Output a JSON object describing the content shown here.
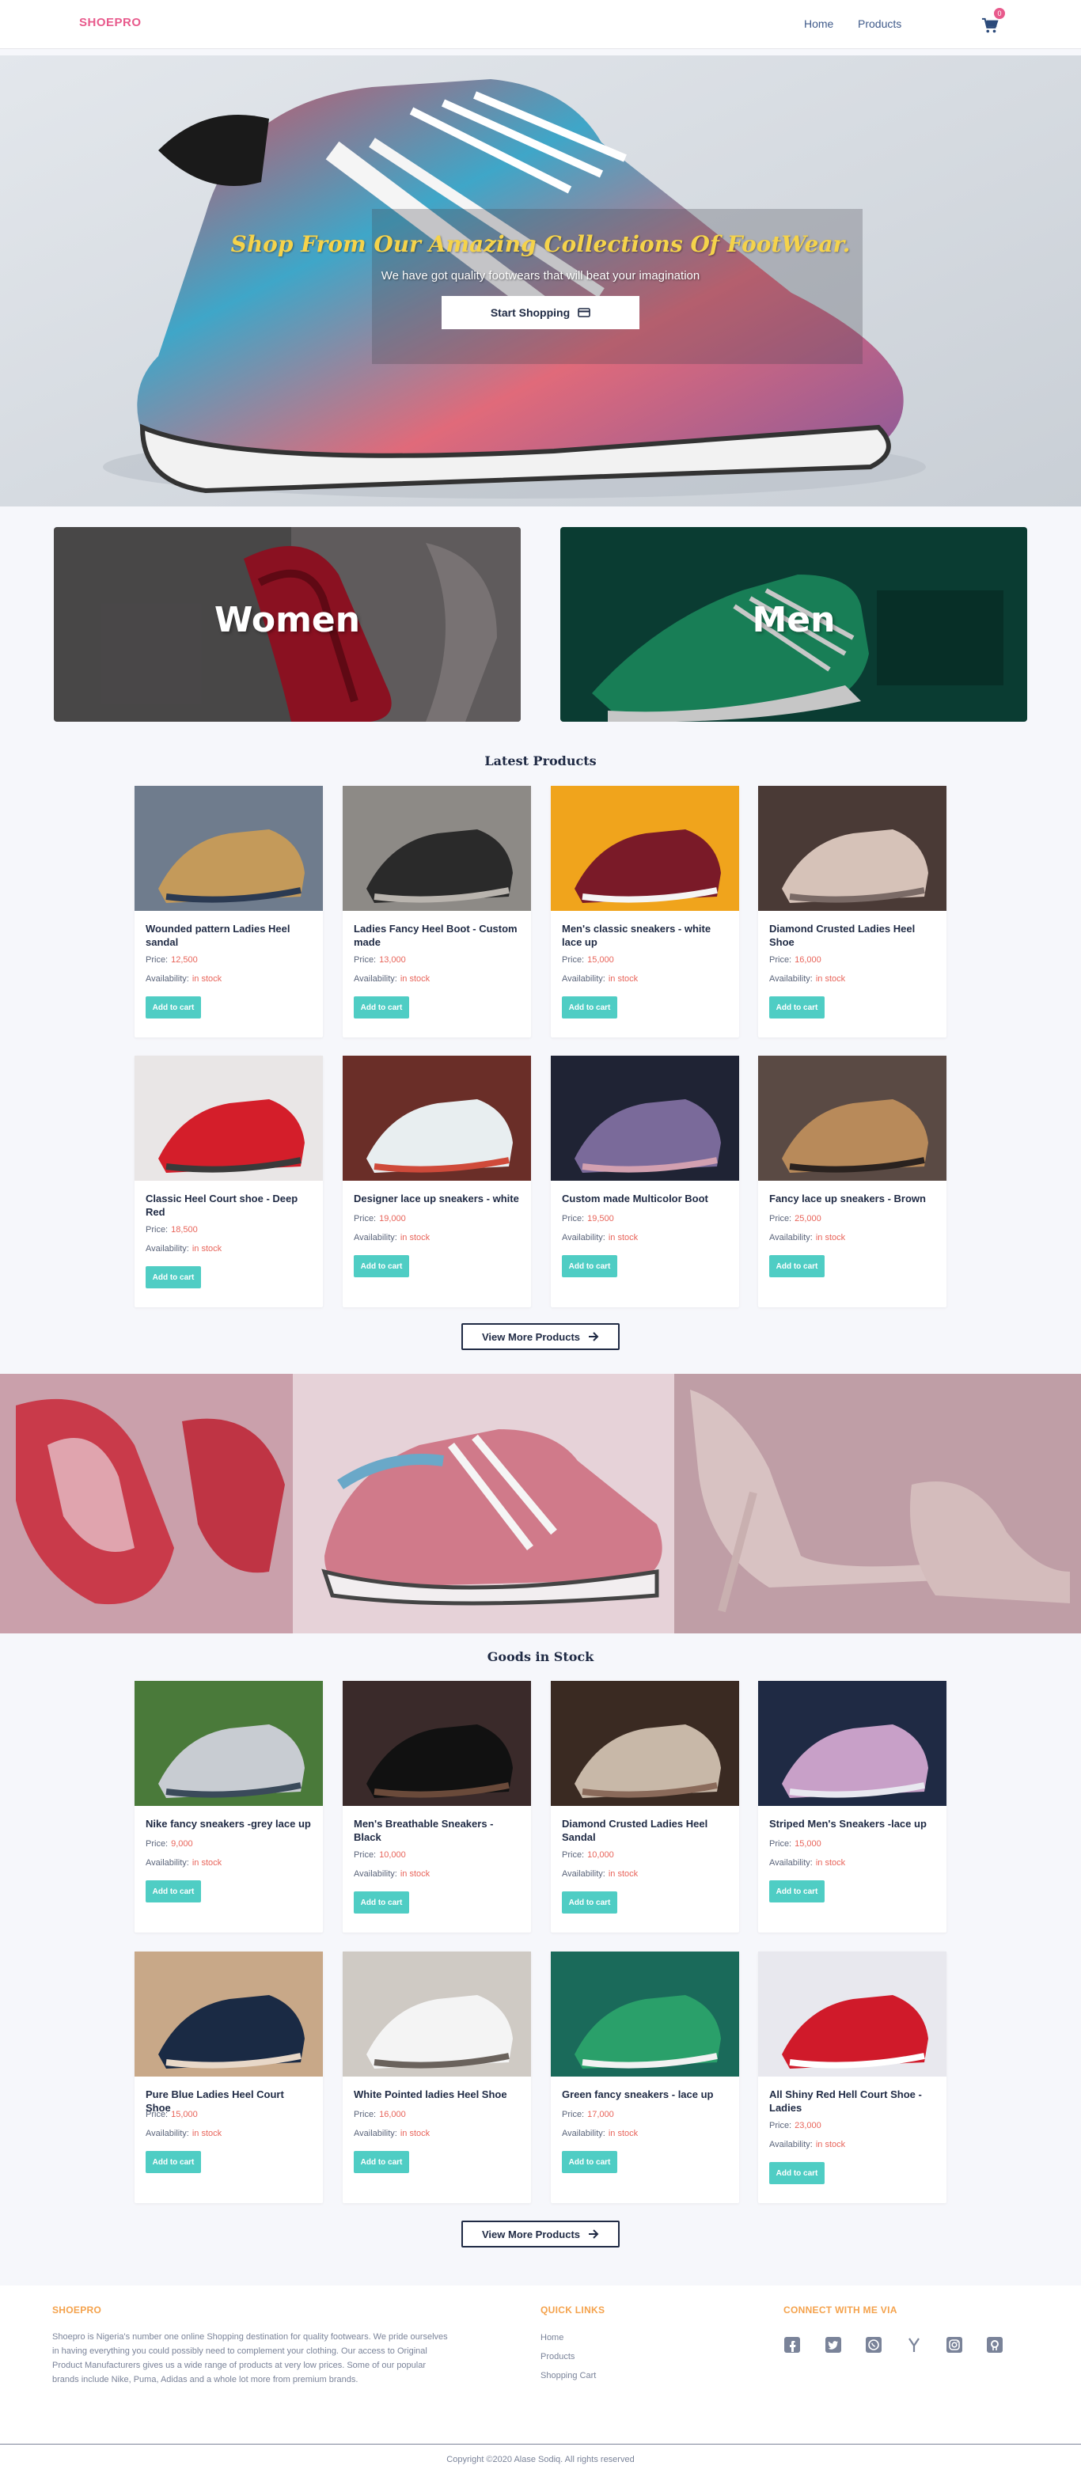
{
  "nav": {
    "brand": "SHOEPRO",
    "links": [
      "Home",
      "Products"
    ],
    "cart_icon": "shopping-cart-icon",
    "cart_count": "0"
  },
  "hero": {
    "title": "Shop From Our Amazing Collections Of FootWear.",
    "subtitle": "We have got quality footwears that will beat your imagination",
    "button": "Start Shopping",
    "button_icon": "credit-card-icon"
  },
  "categories": [
    "Women",
    "Men"
  ],
  "latest": {
    "title": "Latest Products",
    "price_label": "Price:",
    "availability_label": "Availability:",
    "add_label": "Add to cart",
    "products": [
      {
        "name": "Wounded pattern Ladies Heel sandal",
        "price": "12,500",
        "availability": "in stock"
      },
      {
        "name": "Ladies Fancy Heel Boot - Custom made",
        "price": "13,000",
        "availability": "in stock"
      },
      {
        "name": "Men's classic sneakers - white lace up",
        "price": "15,000",
        "availability": "in stock"
      },
      {
        "name": "Diamond Crusted Ladies Heel Shoe",
        "price": "16,000",
        "availability": "in stock"
      },
      {
        "name": "Classic Heel Court shoe - Deep Red",
        "price": "18,500",
        "availability": "in stock"
      },
      {
        "name": "Designer lace up sneakers - white",
        "price": "19,000",
        "availability": "in stock"
      },
      {
        "name": "Custom made Multicolor Boot",
        "price": "19,500",
        "availability": "in stock"
      },
      {
        "name": "Fancy lace up sneakers - Brown",
        "price": "25,000",
        "availability": "in stock"
      }
    ],
    "more_button": "View More Products"
  },
  "stock": {
    "title": "Goods in Stock",
    "price_label": "Price:",
    "availability_label": "Availability:",
    "add_label": "Add to cart",
    "products": [
      {
        "name": "Nike fancy sneakers -grey lace up",
        "price": "9,000",
        "availability": "in stock"
      },
      {
        "name": "Men's Breathable Sneakers - Black",
        "price": "10,000",
        "availability": "in stock"
      },
      {
        "name": "Diamond Crusted Ladies Heel Sandal",
        "price": "10,000",
        "availability": "in stock"
      },
      {
        "name": "Striped Men's Sneakers -lace up",
        "price": "15,000",
        "availability": "in stock"
      },
      {
        "name": "Pure Blue Ladies Heel Court Shoe",
        "price": "15,000",
        "availability": "in stock"
      },
      {
        "name": "White Pointed ladies Heel Shoe",
        "price": "16,000",
        "availability": "in stock"
      },
      {
        "name": "Green fancy sneakers - lace up",
        "price": "17,000",
        "availability": "in stock"
      },
      {
        "name": "All Shiny Red Hell Court Shoe - Ladies",
        "price": "23,000",
        "availability": "in stock"
      }
    ],
    "more_button": "View More Products"
  },
  "footer": {
    "brand": "SHOEPRO",
    "about": "Shoepro is Nigeria's number one online Shopping destination for quality footwears. We pride ourselves in having everything you could possibly need to complement your clothing. Our access to Original Product Manufacturers gives us a wide range of products at very low prices. Some of our popular brands include Nike, Puma, Adidas and a whole lot more from premium brands.",
    "quick_links_title": "QUICK LINKS",
    "quick_links": [
      "Home",
      "Products",
      "Shopping Cart"
    ],
    "connect_title": "CONNECT WITH ME VIA",
    "socials": [
      "facebook-icon",
      "twitter-icon",
      "whatsapp-icon",
      "ycombinator-icon",
      "instagram-icon",
      "github-icon"
    ],
    "copyright": "Copyright ©2020 Alase Sodiq. All rights reserved"
  },
  "colors": {
    "accent": "#4fcdc4",
    "brand": "#e85a8c",
    "price": "#e8645a",
    "hero_title": "#f5d34b",
    "footer_heading": "#f4a24c",
    "ink": "#1f2a44"
  }
}
